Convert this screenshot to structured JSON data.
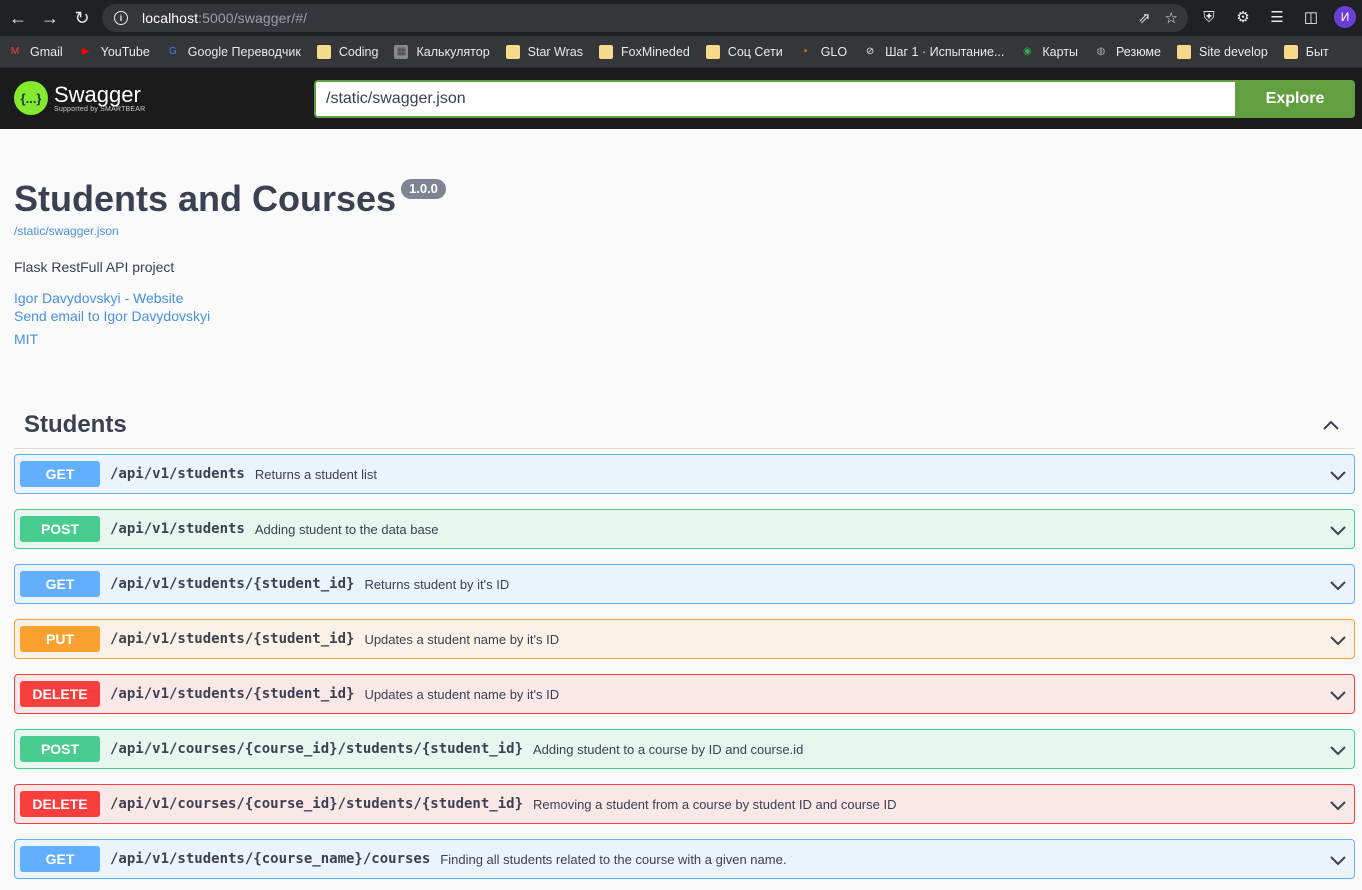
{
  "browser": {
    "url_host": "localhost",
    "url_rest": ":5000/swagger/#/",
    "avatar_letter": "И",
    "bookmarks": [
      {
        "label": "Gmail",
        "icon": "gmail-icon"
      },
      {
        "label": "YouTube",
        "icon": "youtube-icon"
      },
      {
        "label": "Google Переводчик",
        "icon": "translate-icon"
      },
      {
        "label": "Coding",
        "icon": "folder-icon"
      },
      {
        "label": "Калькулятор",
        "icon": "calculator-icon"
      },
      {
        "label": "Star Wras",
        "icon": "folder-icon"
      },
      {
        "label": "FoxMineded",
        "icon": "folder-icon"
      },
      {
        "label": "Соц Сети",
        "icon": "folder-icon"
      },
      {
        "label": "GLO",
        "icon": "glo-icon"
      },
      {
        "label": "Шаг 1 · Испытание...",
        "icon": "link-icon"
      },
      {
        "label": "Карты",
        "icon": "maps-icon"
      },
      {
        "label": "Резюме",
        "icon": "globe-icon"
      },
      {
        "label": "Site develop",
        "icon": "folder-icon"
      },
      {
        "label": "Быт",
        "icon": "folder-icon"
      }
    ]
  },
  "topbar": {
    "logo_text": "Swagger",
    "logo_sub": "Supported by SMARTBEAR",
    "logo_glyph": "{...}",
    "search_value": "/static/swagger.json",
    "explore_label": "Explore",
    "accent": "#62a03f"
  },
  "info": {
    "title": "Students and Courses",
    "version": "1.0.0",
    "spec_url": "/static/swagger.json",
    "description": "Flask RestFull API project",
    "website_link": "Igor Davydovskyi - Website",
    "email_link": "Send email to Igor Davydovskyi",
    "license": "MIT"
  },
  "tag": {
    "name": "Students",
    "operations": [
      {
        "method": "GET",
        "path": "/api/v1/students",
        "summary": "Returns a student list"
      },
      {
        "method": "POST",
        "path": "/api/v1/students",
        "summary": "Adding student to the data base"
      },
      {
        "method": "GET",
        "path": "/api/v1/students/{student_id}",
        "summary": "Returns student by it's ID"
      },
      {
        "method": "PUT",
        "path": "/api/v1/students/{student_id}",
        "summary": "Updates a student name by it's ID"
      },
      {
        "method": "DELETE",
        "path": "/api/v1/students/{student_id}",
        "summary": "Updates a student name by it's ID"
      },
      {
        "method": "POST",
        "path": "/api/v1/courses/{course_id}/students/{student_id}",
        "summary": "Adding student to a course by ID and course.id"
      },
      {
        "method": "DELETE",
        "path": "/api/v1/courses/{course_id}/students/{student_id}",
        "summary": "Removing a student from a course by student ID and course ID"
      },
      {
        "method": "GET",
        "path": "/api/v1/students/{course_name}/courses",
        "summary": "Finding all students related to the course with a given name."
      }
    ]
  },
  "method_colors": {
    "GET": "#61affe",
    "POST": "#49cc90",
    "PUT": "#fca130",
    "DELETE": "#f93e3e"
  }
}
